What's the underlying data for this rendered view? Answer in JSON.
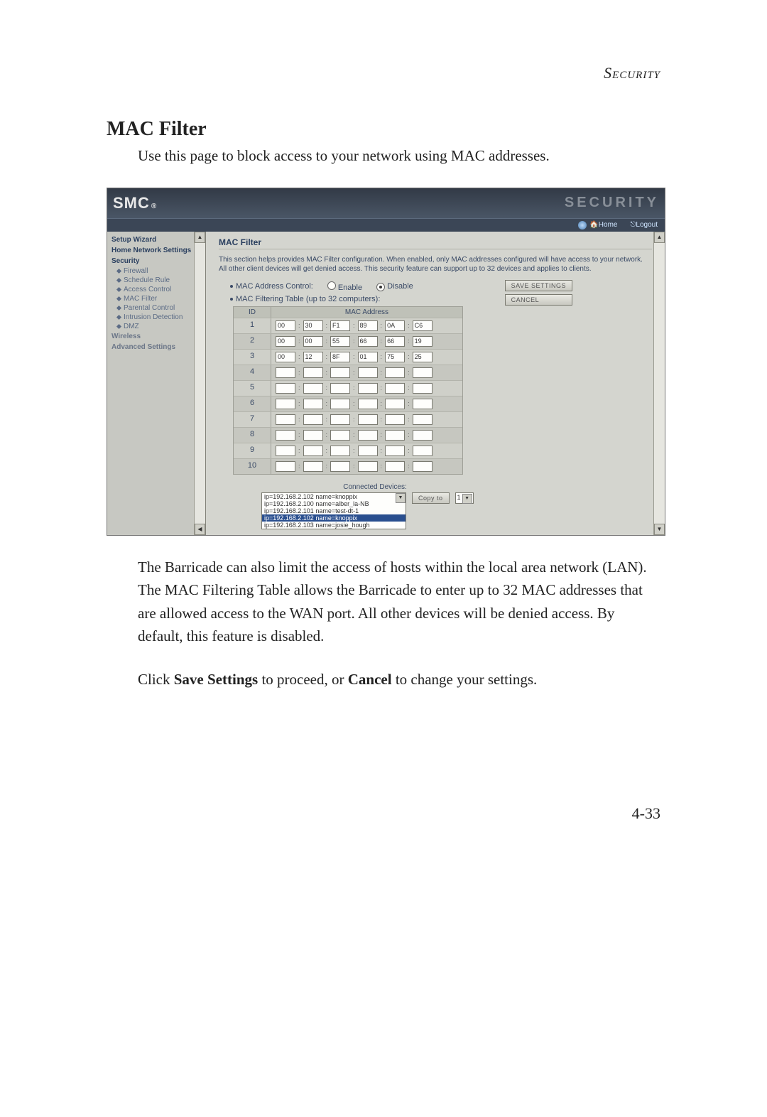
{
  "runningHead": "Security",
  "heading": "MAC Filter",
  "intro": "Use this page to block access to your network using MAC addresses.",
  "bodyPara1": "The Barricade can also limit the access of hosts within the local area network (LAN). The MAC Filtering Table allows the Barricade to enter up to 32 MAC addresses that are allowed access to the WAN port. All other devices will be denied access. By default, this feature is disabled.",
  "bodyPara2_pre": "Click ",
  "bodyPara2_b1": "Save Settings",
  "bodyPara2_mid": " to proceed, or ",
  "bodyPara2_b2": "Cancel",
  "bodyPara2_post": " to change your settings.",
  "pageNumber": "4-33",
  "shot": {
    "brand": "SMC",
    "brandSup": "®",
    "secLabel": "SECURITY",
    "toolbar": {
      "home": "Home",
      "logout": "Logout"
    },
    "sidebar": {
      "items": [
        {
          "label": "Setup Wizard",
          "type": "head"
        },
        {
          "label": "Home Network Settings",
          "type": "head"
        },
        {
          "label": "Security",
          "type": "head"
        },
        {
          "label": "Firewall",
          "type": "item"
        },
        {
          "label": "Schedule Rule",
          "type": "item"
        },
        {
          "label": "Access Control",
          "type": "item"
        },
        {
          "label": "MAC Filter",
          "type": "item"
        },
        {
          "label": "Parental Control",
          "type": "item"
        },
        {
          "label": "Intrusion Detection",
          "type": "item"
        },
        {
          "label": "DMZ",
          "type": "item"
        },
        {
          "label": "Wireless",
          "type": "headdim"
        },
        {
          "label": "Advanced Settings",
          "type": "headdim"
        }
      ]
    },
    "main": {
      "title": "MAC Filter",
      "blurb": "This section helps provides MAC Filter configuration. When enabled, only MAC addresses configured will have access to your network. All other client devices will get denied access. This security feature can support up to 32 devices and applies to clients.",
      "controlLabel": "MAC Address Control:",
      "enable": "Enable",
      "disable": "Disable",
      "tableNote": "MAC Filtering Table (up to 32 computers):",
      "saveBtn": "SAVE SETTINGS",
      "cancelBtn": "CANCEL",
      "col1": "ID",
      "col2": "MAC Address",
      "rows": [
        {
          "id": "1",
          "m": [
            "00",
            "30",
            "F1",
            "89",
            "0A",
            "C6"
          ]
        },
        {
          "id": "2",
          "m": [
            "00",
            "00",
            "55",
            "66",
            "66",
            "19"
          ]
        },
        {
          "id": "3",
          "m": [
            "00",
            "12",
            "8F",
            "01",
            "75",
            "25"
          ]
        },
        {
          "id": "4",
          "m": [
            "",
            "",
            "",
            "",
            "",
            ""
          ]
        },
        {
          "id": "5",
          "m": [
            "",
            "",
            "",
            "",
            "",
            ""
          ]
        },
        {
          "id": "6",
          "m": [
            "",
            "",
            "",
            "",
            "",
            ""
          ]
        },
        {
          "id": "7",
          "m": [
            "",
            "",
            "",
            "",
            "",
            ""
          ]
        },
        {
          "id": "8",
          "m": [
            "",
            "",
            "",
            "",
            "",
            ""
          ]
        },
        {
          "id": "9",
          "m": [
            "",
            "",
            "",
            "",
            "",
            ""
          ]
        },
        {
          "id": "10",
          "m": [
            "",
            "",
            "",
            "",
            "",
            ""
          ]
        }
      ],
      "connectedCap": "Connected Devices:",
      "copyTo": "Copy to",
      "copyVal": "1",
      "devices": [
        "ip=192.168.2.102 name=knoppix",
        "ip=192.168.2.100 name=alber_la-NB",
        "ip=192.168.2.101 name=test-dt-1",
        "ip=192.168.2.102 name=knoppix",
        "ip=192.168.2.103 name=josie_hough"
      ]
    }
  }
}
